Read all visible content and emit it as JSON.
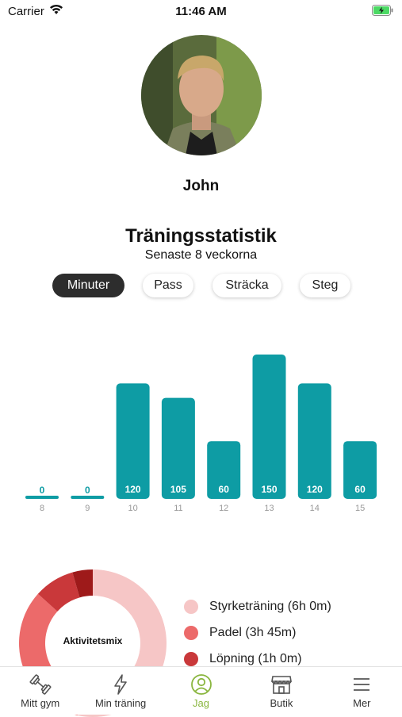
{
  "status_bar": {
    "carrier": "Carrier",
    "time": "11:46 AM"
  },
  "profile": {
    "name": "John"
  },
  "stats": {
    "title": "Träningsstatistik",
    "subtitle": "Senaste 8 veckorna",
    "segments": [
      "Minuter",
      "Pass",
      "Sträcka",
      "Steg"
    ],
    "active_segment": "Minuter"
  },
  "chart_data": {
    "type": "bar",
    "categories": [
      "8",
      "9",
      "10",
      "11",
      "12",
      "13",
      "14",
      "15"
    ],
    "values": [
      0,
      0,
      120,
      105,
      60,
      150,
      120,
      60
    ],
    "ylim": [
      0,
      150
    ],
    "bar_color": "#0e9ca4",
    "data_labels": true,
    "grid": false
  },
  "activity_mix": {
    "label": "Aktivitetsmix",
    "items": [
      {
        "label": "Styrketräning (6h 0m)",
        "color": "#f6c6c6",
        "minutes": 360
      },
      {
        "label": "Padel (3h 45m)",
        "color": "#ec6a6a",
        "minutes": 225
      },
      {
        "label": "Löpning (1h 0m)",
        "color": "#c9383a",
        "minutes": 60
      },
      {
        "label": "",
        "color": "#9e1a1a",
        "minutes": 30
      }
    ]
  },
  "tabbar": {
    "tabs": [
      {
        "label": "Mitt gym",
        "icon": "dumbbell-icon"
      },
      {
        "label": "Min träning",
        "icon": "lightning-icon"
      },
      {
        "label": "Jag",
        "icon": "user-icon"
      },
      {
        "label": "Butik",
        "icon": "store-icon"
      },
      {
        "label": "Mer",
        "icon": "menu-icon"
      }
    ],
    "active": "Jag",
    "accent": "#8ab63f"
  }
}
